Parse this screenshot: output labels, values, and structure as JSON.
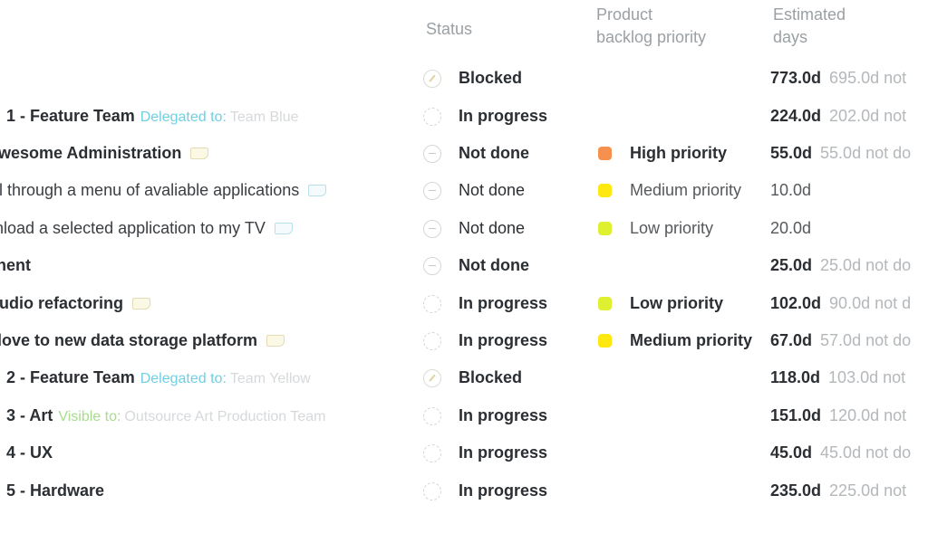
{
  "columns": {
    "status": "Status",
    "priority_line1": "Product",
    "priority_line2": "backlog priority",
    "days_line1": "Estimated",
    "days_line2": "days"
  },
  "colors": {
    "high_priority": "#f5904f",
    "medium_priority": "#fde910",
    "low_priority": "#def030",
    "delegated_label": "#6fd0e2",
    "visible_label": "#a8dc8c"
  },
  "rows": [
    {
      "name": "",
      "status": "Blocked",
      "status_icon": "blocked-icon",
      "priority": "",
      "total_days": "773.0d",
      "remaining": "695.0d not"
    },
    {
      "name": "1 - Feature Team",
      "tag_label": "Delegated to:",
      "tag_value": "Team Blue",
      "status": "In progress",
      "status_icon": "in-progress-icon",
      "priority": "",
      "total_days": "224.0d",
      "remaining": "202.0d not"
    },
    {
      "name": "wesome Administration",
      "status": "Not done",
      "status_icon": "not-done-icon",
      "priority": "High priority",
      "total_days": "55.0d",
      "remaining": "55.0d not do"
    },
    {
      "name": "l through a menu of avaliable applications",
      "status": "Not done",
      "status_icon": "not-done-icon",
      "priority": "Medium priority",
      "total_days": "10.0d",
      "remaining": ""
    },
    {
      "name": "nload a selected application to my TV",
      "status": "Not done",
      "status_icon": "not-done-icon",
      "priority": "Low priority",
      "total_days": "20.0d",
      "remaining": ""
    },
    {
      "name": "nent",
      "status": "Not done",
      "status_icon": "not-done-icon",
      "priority": "",
      "total_days": "25.0d",
      "remaining": "25.0d not do"
    },
    {
      "name": "udio refactoring",
      "status": "In progress",
      "status_icon": "in-progress-icon",
      "priority": "Low priority",
      "total_days": "102.0d",
      "remaining": "90.0d not d"
    },
    {
      "name": "love to new data storage platform",
      "status": "In progress",
      "status_icon": "in-progress-icon",
      "priority": "Medium priority",
      "total_days": "67.0d",
      "remaining": "57.0d not do"
    },
    {
      "name": "2 - Feature Team",
      "tag_label": "Delegated to:",
      "tag_value": "Team Yellow",
      "status": "Blocked",
      "status_icon": "blocked-icon",
      "priority": "",
      "total_days": "118.0d",
      "remaining": "103.0d not"
    },
    {
      "name": "3 - Art",
      "tag_label": "Visible to:",
      "tag_value": "Outsource Art Production Team",
      "status": "In progress",
      "status_icon": "in-progress-icon",
      "priority": "",
      "total_days": "151.0d",
      "remaining": "120.0d not"
    },
    {
      "name": "4 - UX",
      "status": "In progress",
      "status_icon": "in-progress-icon",
      "priority": "",
      "total_days": "45.0d",
      "remaining": "45.0d not do"
    },
    {
      "name": "5 - Hardware",
      "status": "In progress",
      "status_icon": "in-progress-icon",
      "priority": "",
      "total_days": "235.0d",
      "remaining": "225.0d not"
    }
  ]
}
